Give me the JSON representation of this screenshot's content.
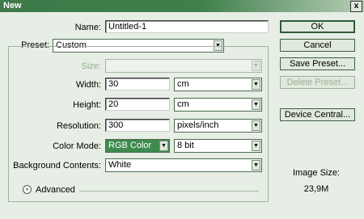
{
  "window": {
    "title": "New",
    "close_glyph": "x"
  },
  "form": {
    "name_label": "Name:",
    "name_value": "Untitled-1",
    "preset_label": "Preset:",
    "preset_value": "Custom",
    "size_label": "Size:",
    "size_value": "",
    "width_label": "Width:",
    "width_value": "30",
    "width_unit": "cm",
    "height_label": "Height:",
    "height_value": "20",
    "height_unit": "cm",
    "resolution_label": "Resolution:",
    "resolution_value": "300",
    "resolution_unit": "pixels/inch",
    "color_mode_label": "Color Mode:",
    "color_mode_value": "RGB Color",
    "bit_depth_value": "8 bit",
    "background_label": "Background Contents:",
    "background_value": "White",
    "advanced_label": "Advanced"
  },
  "buttons": {
    "ok": "OK",
    "cancel": "Cancel",
    "save_preset": "Save Preset...",
    "delete_preset": "Delete Preset...",
    "device_central": "Device Central..."
  },
  "info": {
    "image_size_label": "Image Size:",
    "image_size_value": "23,9M"
  },
  "icons": {
    "dropdown_arrow": "▼",
    "expand_icon": "»"
  },
  "colors": {
    "titlebar": "#3e7a49",
    "background": "#e7eee5",
    "highlight": "#3e8b4e"
  }
}
